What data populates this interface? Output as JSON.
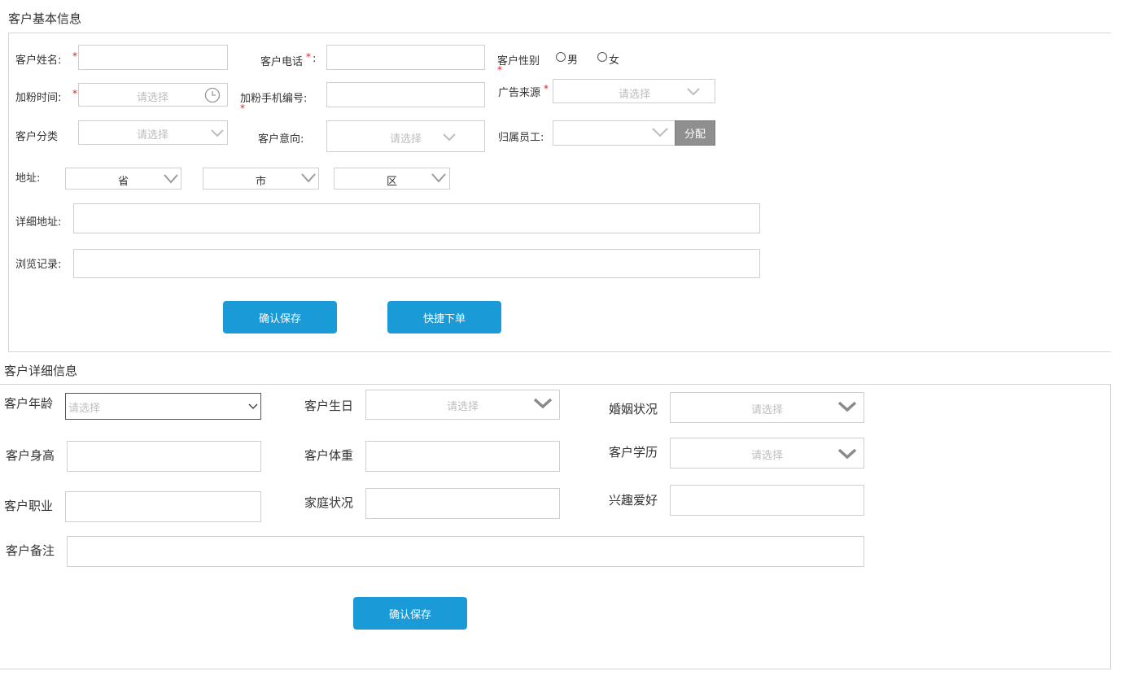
{
  "basic": {
    "title": "客户基本信息",
    "name_label": "客户姓名:",
    "phone_label": "客户电话",
    "phone_colon": ":",
    "gender_label": "客户性别",
    "gender_male": "男",
    "gender_female": "女",
    "add_time_label": "加粉时间:",
    "add_time_placeholder": "请选择",
    "add_phone_no_label": "加粉手机编号:",
    "ad_source_label": "广告来源",
    "ad_source_placeholder": "请选择",
    "category_label": "客户分类",
    "category_placeholder": "请选择",
    "intent_label": "客户意向:",
    "intent_placeholder": "请选择",
    "owner_label": "归属员工:",
    "assign_button": "分配",
    "address_label": "地址:",
    "province": "省",
    "city": "市",
    "district": "区",
    "detail_address_label": "详细地址:",
    "browse_label": "浏览记录:",
    "save_button": "确认保存",
    "quick_order_button": "快捷下单"
  },
  "detail": {
    "title": "客户详细信息",
    "age_label": "客户年龄",
    "age_placeholder": "请选择",
    "birthday_label": "客户生日",
    "birthday_placeholder": "请选择",
    "marital_label": "婚姻状况",
    "marital_placeholder": "请选择",
    "height_label": "客户身高",
    "weight_label": "客户体重",
    "education_label": "客户学历",
    "education_placeholder": "请选择",
    "job_label": "客户职业",
    "family_label": "家庭状况",
    "hobby_label": "兴趣爱好",
    "remark_label": "客户备注",
    "save_button": "确认保存"
  },
  "colors": {
    "primary": "#1a9ad6",
    "required": "#e02020",
    "assign_bg": "#8f8f8f"
  }
}
